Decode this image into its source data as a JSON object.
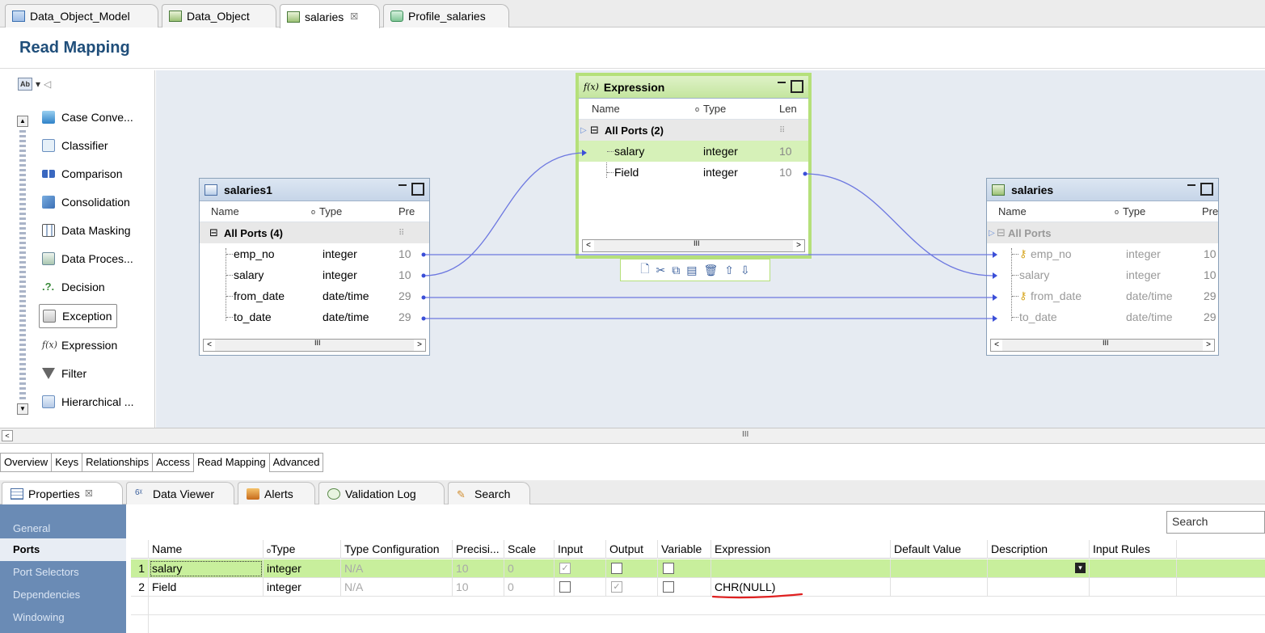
{
  "editor_tabs": [
    {
      "label": "Data_Object_Model",
      "icon": "data-object-model-icon"
    },
    {
      "label": "Data_Object",
      "icon": "data-object-icon"
    },
    {
      "label": "salaries",
      "icon": "data-object-icon",
      "active": true,
      "close": "☒"
    },
    {
      "label": "Profile_salaries",
      "icon": "profile-icon"
    }
  ],
  "page_title": "Read Mapping",
  "palette": {
    "toolbar_caret": "▾",
    "toolbar_arrow": "◁",
    "items": [
      "Case Conve...",
      "Classifier",
      "Comparison",
      "Consolidation",
      "Data Masking",
      "Data Proces...",
      "Decision",
      "Exception",
      "Expression",
      "Filter",
      "Hierarchical ..."
    ],
    "selected": "Exception"
  },
  "transformations": {
    "source": {
      "title": "salaries1",
      "col_name": "Name",
      "col_type": "Type",
      "col_len": "Pre",
      "group": "All Ports (4)",
      "ports": [
        {
          "name": "emp_no",
          "type": "integer",
          "len": "10"
        },
        {
          "name": "salary",
          "type": "integer",
          "len": "10"
        },
        {
          "name": "from_date",
          "type": "date/time",
          "len": "29"
        },
        {
          "name": "to_date",
          "type": "date/time",
          "len": "29"
        }
      ]
    },
    "expression": {
      "title": "Expression",
      "col_name": "Name",
      "col_type": "Type",
      "col_len": "Len",
      "group": "All Ports (2)",
      "ports": [
        {
          "name": "salary",
          "type": "integer",
          "len": "10"
        },
        {
          "name": "Field",
          "type": "integer",
          "len": "10"
        }
      ]
    },
    "target": {
      "title": "salaries",
      "col_name": "Name",
      "col_type": "Type",
      "col_len": "Pre",
      "group": "All Ports",
      "ports": [
        {
          "name": "emp_no",
          "type": "integer",
          "len": "10",
          "key": true
        },
        {
          "name": "salary",
          "type": "integer",
          "len": "10",
          "key": false
        },
        {
          "name": "from_date",
          "type": "date/time",
          "len": "29",
          "key": true
        },
        {
          "name": "to_date",
          "type": "date/time",
          "len": "29",
          "key": false
        }
      ]
    }
  },
  "editor_subtabs": [
    "Overview",
    "Keys",
    "Relationships",
    "Access",
    "Read Mapping",
    "Advanced"
  ],
  "active_subtab": "Read Mapping",
  "view_tabs": [
    {
      "label": "Properties",
      "active": true,
      "close": "☒"
    },
    {
      "label": "Data Viewer"
    },
    {
      "label": "Alerts"
    },
    {
      "label": "Validation Log"
    },
    {
      "label": "Search"
    }
  ],
  "properties_nav": [
    "General",
    "Ports",
    "Port Selectors",
    "Dependencies",
    "Windowing"
  ],
  "properties_selected": "Ports",
  "search_placeholder": "Search",
  "ports_grid": {
    "headers": [
      "Name",
      "Type",
      "Type Configuration",
      "Precisi...",
      "Scale",
      "Input",
      "Output",
      "Variable",
      "Expression",
      "Default Value",
      "Description",
      "Input Rules"
    ],
    "rows": [
      {
        "num": "1",
        "name": "salary",
        "type": "integer",
        "type_config": "N/A",
        "precision": "10",
        "scale": "0",
        "input": true,
        "output": false,
        "variable": false,
        "expression": "",
        "default_value": "",
        "description": ""
      },
      {
        "num": "2",
        "name": "Field",
        "type": "integer",
        "type_config": "N/A",
        "precision": "10",
        "scale": "0",
        "input": false,
        "output": true,
        "variable": false,
        "expression": "CHR(NULL)",
        "default_value": "",
        "description": ""
      }
    ]
  },
  "colors": {
    "accent_title": "#1f4e7a",
    "link": "#3b4fd8",
    "selected_row": "#c8ef9c",
    "expression_border": "#b5e07a",
    "annotation": "#e02020"
  }
}
